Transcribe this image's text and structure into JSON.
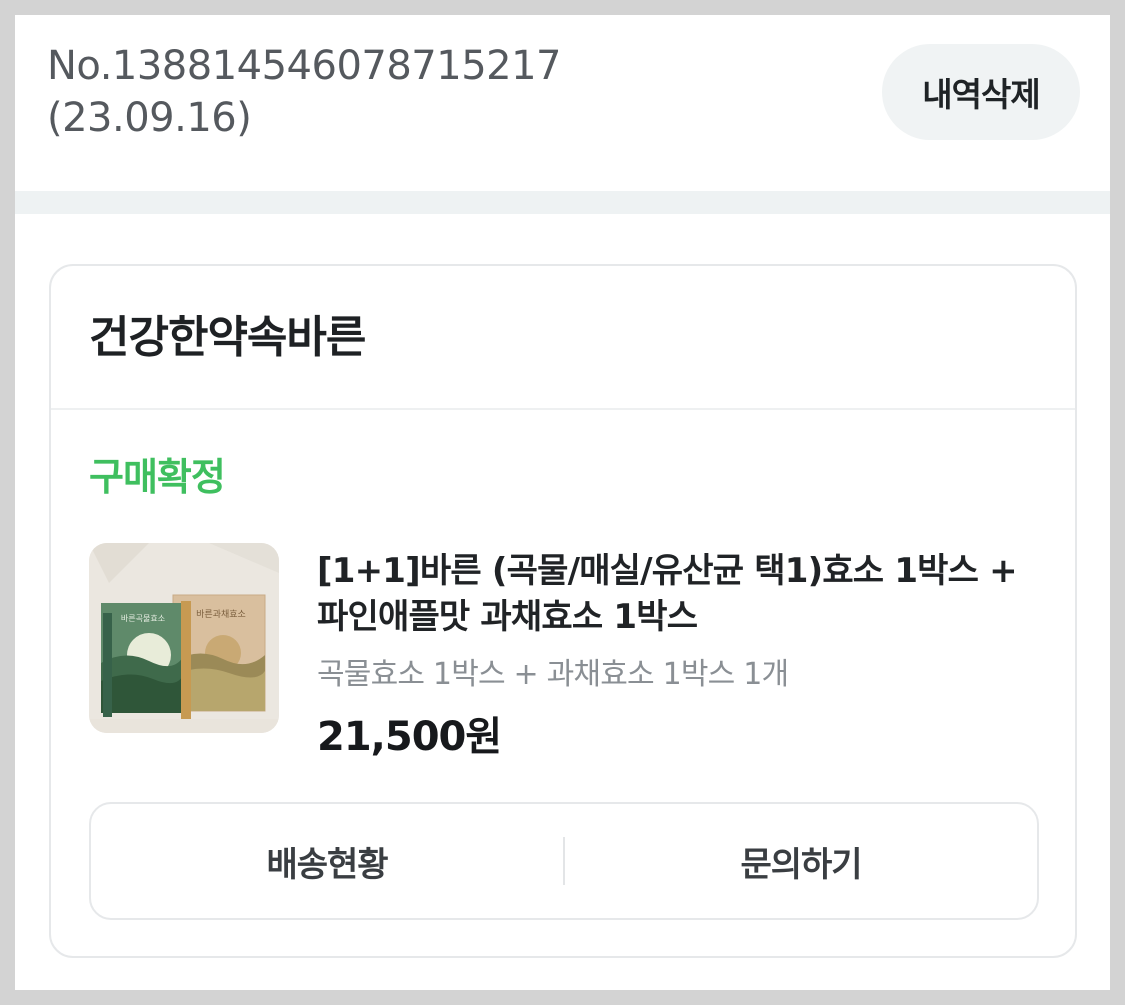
{
  "order": {
    "number": "No.1388145460787 15217",
    "number_display": "No.138814546078715217",
    "date": "(23.09.16)",
    "delete_label": "내역삭제"
  },
  "store": {
    "name": "건강한약속바른"
  },
  "item": {
    "status": "구매확정",
    "status_color": "#3fbf5f",
    "title": "[1+1]바른 (곡물/매실/유산균 택1)효소 1박스 + 파인애플맛 과채효소 1박스",
    "option": "곡물효소 1박스 + 과채효소 1박스 1개",
    "price": "21,500원",
    "thumbnail_icon": "product-box-image"
  },
  "actions": {
    "tracking_label": "배송현황",
    "inquiry_label": "문의하기"
  },
  "colors": {
    "accent_green": "#3fbf5f",
    "frame_border": "#d3d3d3",
    "band": "#eef2f3"
  }
}
